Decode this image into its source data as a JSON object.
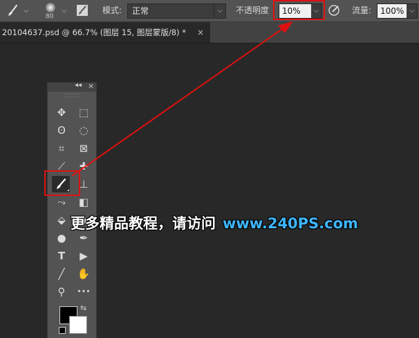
{
  "options_bar": {
    "brush_size": "80",
    "mode_label": "模式:",
    "mode_value": "正常",
    "opacity_label": "不透明度",
    "opacity_value": "10%",
    "flow_label": "流量:",
    "flow_value": "100%"
  },
  "document_tab": {
    "title": "20104637.psd @ 66.7% (图层 15, 图层蒙版/8) *",
    "close": "×"
  },
  "toolbar_header": {
    "collapse": "◂◂",
    "close": "×"
  },
  "tools": [
    {
      "name": "move-tool",
      "glyph": "✥"
    },
    {
      "name": "rectangular-marquee-tool",
      "glyph": "⬚"
    },
    {
      "name": "lasso-tool",
      "glyph": "ʘ"
    },
    {
      "name": "quick-selection-tool",
      "glyph": "◌"
    },
    {
      "name": "crop-tool",
      "glyph": "⌗"
    },
    {
      "name": "frame-tool",
      "glyph": "⊠"
    },
    {
      "name": "eyedropper-tool",
      "glyph": "⟋"
    },
    {
      "name": "healing-brush-tool",
      "glyph": "✚"
    },
    {
      "name": "brush-tool",
      "glyph": ""
    },
    {
      "name": "clone-stamp-tool",
      "glyph": "⊥"
    },
    {
      "name": "history-brush-tool",
      "glyph": "⤳"
    },
    {
      "name": "eraser-tool",
      "glyph": "◧"
    },
    {
      "name": "paint-bucket-tool",
      "glyph": "⬙"
    },
    {
      "name": "blur-tool",
      "glyph": "◆"
    },
    {
      "name": "dodge-tool",
      "glyph": "●"
    },
    {
      "name": "pen-tool",
      "glyph": "✒"
    },
    {
      "name": "type-tool",
      "glyph": "T"
    },
    {
      "name": "path-selection-tool",
      "glyph": "▶"
    },
    {
      "name": "line-tool",
      "glyph": "╱"
    },
    {
      "name": "hand-tool",
      "glyph": "✋"
    },
    {
      "name": "zoom-tool",
      "glyph": "⚲"
    },
    {
      "name": "more-tools",
      "glyph": "•••"
    }
  ],
  "colors": {
    "foreground": "#000000",
    "background": "#ffffff",
    "annotation": "#e01010",
    "watermark_url": "#3fb6ff"
  },
  "watermark": {
    "text": "更多精品教程，请访问",
    "url": "www.240PS.com"
  }
}
